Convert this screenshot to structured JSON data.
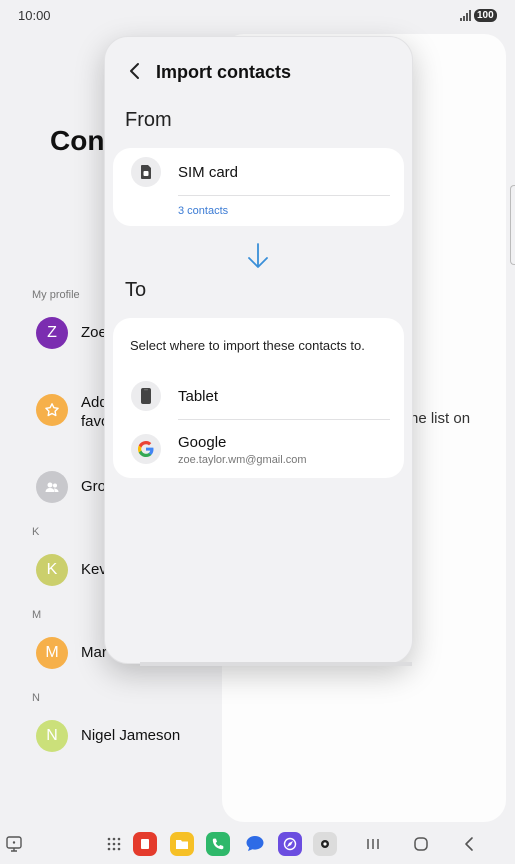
{
  "status": {
    "time": "10:00",
    "battery": "100"
  },
  "background": {
    "title": "Con",
    "sections": {
      "my_profile": "My profile",
      "k": "K",
      "m": "M",
      "n": "N"
    },
    "contacts": [
      {
        "initial": "Z",
        "name": "Zoe",
        "color": "#7b2db0"
      },
      {
        "initial": "",
        "name": "Add",
        "name2": "favo",
        "color": "#f6b04a"
      },
      {
        "initial": "",
        "name": "Gro",
        "color": "#c8c8cc"
      },
      {
        "initial": "K",
        "name": "Kev",
        "color": "#cbcf6c"
      },
      {
        "initial": "M",
        "name": "Mar",
        "color": "#f6b04a"
      },
      {
        "initial": "N",
        "name": "Nigel Jameson",
        "color": "#cbe07a"
      }
    ],
    "right_pane_text": "he list on"
  },
  "dialog": {
    "title": "Import contacts",
    "from_label": "From",
    "to_label": "To",
    "source": {
      "title": "SIM card",
      "count": "3 contacts"
    },
    "instruction": "Select where to import these contacts to.",
    "targets": [
      {
        "title": "Tablet",
        "sub": ""
      },
      {
        "title": "Google",
        "sub": "zoe.taylor.wm@gmail.com"
      }
    ]
  },
  "colors": {
    "accent": "#3b7bd4",
    "arrow": "#3a8fd8"
  }
}
